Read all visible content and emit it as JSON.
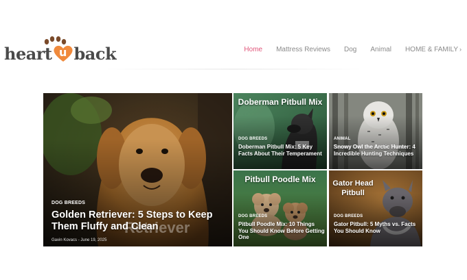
{
  "logo": {
    "part1": "heart",
    "part2": "u",
    "part3": "back"
  },
  "nav": [
    {
      "label": "Home",
      "active": true
    },
    {
      "label": "Mattress Reviews",
      "active": false
    },
    {
      "label": "Dog",
      "active": false
    },
    {
      "label": "Animal",
      "active": false
    },
    {
      "label": "HOME & FAMILY",
      "active": false,
      "has_submenu": true
    }
  ],
  "colors": {
    "accent": "#e0567a",
    "logo_heart": "#f08a3c",
    "paws": "#7a4a2a"
  },
  "featured": {
    "category": "DOG BREEDS",
    "title": "Golden Retriever: 5 Steps to Keep Them Fluffy and Clean",
    "watermark": "Retriever",
    "author": "Gavin Kovacs",
    "date": "June 19, 2025"
  },
  "cards": [
    {
      "image_title": "Doberman Pitbull Mix",
      "category": "DOG BREEDS",
      "title": "Doberman Pitbull Mix: 5 Key Facts About Their Temperament"
    },
    {
      "image_title": "",
      "faint_text": "Snowy Owl the Arctic Hunte",
      "category": "ANIMAL",
      "title": "Snowy Owl the Arctic Hunter: 4 Incredible Hunting Techniques"
    },
    {
      "image_title": "Pitbull Poodle Mix",
      "category": "DOG BREEDS",
      "title": "Pitbull Poodle Mix: 10 Things You Should Know Before Getting One"
    },
    {
      "image_title": "Gator Head Pitbull",
      "category": "DOG BREEDS",
      "title": "Gator Pitbull: 5 Myths vs. Facts You Should Know"
    }
  ]
}
